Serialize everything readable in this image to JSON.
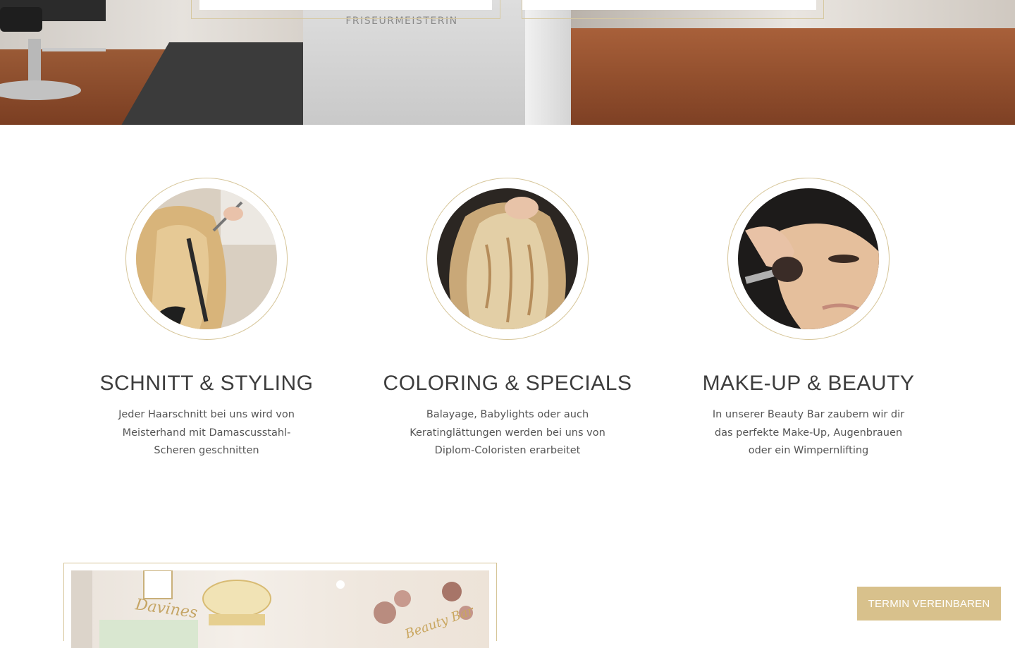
{
  "hero": {
    "sign_text": "FRISEURMEISTERIN"
  },
  "services": [
    {
      "title": "SCHNITT & STYLING",
      "text": "Jeder Haarschnitt bei uns wird von Meisterhand mit Damascusstahl-Scheren geschnitten"
    },
    {
      "title": "COLORING & SPECIALS",
      "text": "Balayage, Babylights oder auch Keratinglättungen werden bei uns von Diplom-Coloristen erarbeitet"
    },
    {
      "title": "MAKE-UP & BEAUTY",
      "text": "In unserer Beauty Bar zaubern wir dir das perfekte Make-Up, Augenbrauen oder ein Wimpernlifting"
    }
  ],
  "salon_photo": {
    "logo_text": "Davines",
    "wall_text": "Beauty Bar"
  },
  "cta": {
    "label": "TERMIN VEREINBAREN"
  },
  "colors": {
    "gold": "#d8c18c",
    "gold_border": "#d6c598",
    "heading": "#3d3d3d",
    "body_text": "#555555"
  }
}
